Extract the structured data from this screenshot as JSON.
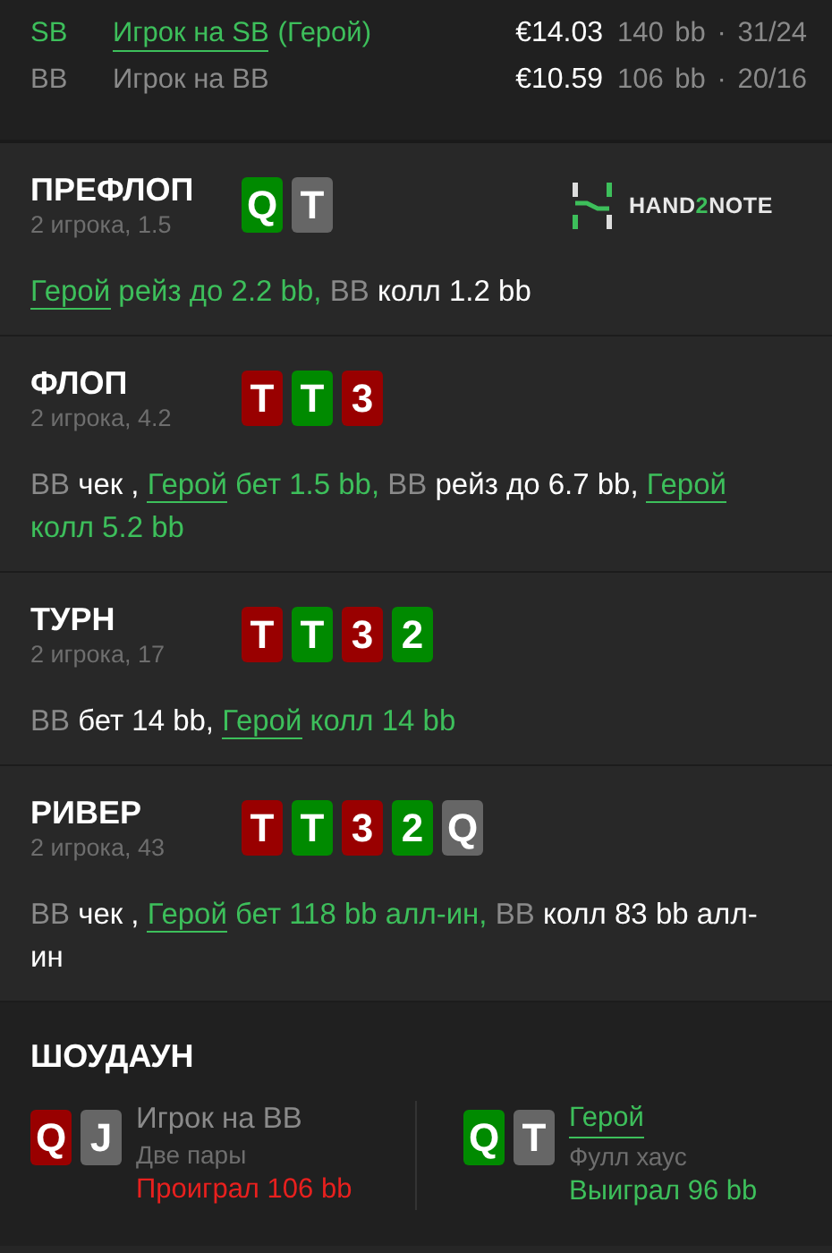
{
  "players": [
    {
      "position": "SB",
      "name": "Игрок на SB",
      "tag": "(Герой)",
      "hero": true,
      "stack": "€14.03",
      "stats": "140 bb · 31/24"
    },
    {
      "position": "BB",
      "name": "Игрок на BB",
      "hero": false,
      "stack": "€10.59",
      "stats": "106 bb · 20/16"
    }
  ],
  "streets": [
    {
      "title": "ПРЕФЛОП",
      "subtitle": "2 игрока, 1.5",
      "cards": [
        {
          "rank": "Q",
          "color": "#008a00"
        },
        {
          "rank": "T",
          "color": "#666666"
        }
      ],
      "logo": {
        "prefix": "HAND",
        "accent": "2",
        "suffix": "NOTE"
      },
      "actions": [
        {
          "actor": "Герой",
          "text": "рейз до 2.2 bb,",
          "hero": true
        },
        {
          "actor": "BB",
          "text": "колл 1.2 bb",
          "hero": false
        }
      ]
    },
    {
      "title": "ФЛОП",
      "subtitle": "2 игрока, 4.2",
      "cards": [
        {
          "rank": "T",
          "color": "#990000"
        },
        {
          "rank": "T",
          "color": "#008a00"
        },
        {
          "rank": "3",
          "color": "#990000"
        }
      ],
      "actions": [
        {
          "actor": "BB",
          "text": "чек ,",
          "hero": false
        },
        {
          "actor": "Герой",
          "text": "бет 1.5 bb,",
          "hero": true
        },
        {
          "actor": "BB",
          "text": "рейз до 6.7 bb,",
          "hero": false
        },
        {
          "actor": "Герой",
          "text": "колл 5.2 bb",
          "hero": true
        }
      ]
    },
    {
      "title": "ТУРН",
      "subtitle": "2 игрока, 17",
      "cards": [
        {
          "rank": "T",
          "color": "#990000"
        },
        {
          "rank": "T",
          "color": "#008a00"
        },
        {
          "rank": "3",
          "color": "#990000"
        },
        {
          "rank": "2",
          "color": "#008a00"
        }
      ],
      "actions": [
        {
          "actor": "BB",
          "text": "бет 14 bb,",
          "hero": false
        },
        {
          "actor": "Герой",
          "text": "колл 14 bb",
          "hero": true
        }
      ]
    },
    {
      "title": "РИВЕР",
      "subtitle": "2 игрока, 43",
      "cards": [
        {
          "rank": "T",
          "color": "#990000"
        },
        {
          "rank": "T",
          "color": "#008a00"
        },
        {
          "rank": "3",
          "color": "#990000"
        },
        {
          "rank": "2",
          "color": "#008a00"
        },
        {
          "rank": "Q",
          "color": "#666666"
        }
      ],
      "actions": [
        {
          "actor": "BB",
          "text": "чек ,",
          "hero": false
        },
        {
          "actor": "Герой",
          "text": "бет 118 bb алл-ин,",
          "hero": true
        },
        {
          "actor": "BB",
          "text": "колл 83 bb алл-ин",
          "hero": false
        }
      ]
    }
  ],
  "showdown": {
    "title": "ШОУДАУН",
    "players": [
      {
        "cards": [
          {
            "rank": "Q",
            "color": "#990000"
          },
          {
            "rank": "J",
            "color": "#666666"
          }
        ],
        "name": "Игрок на BB",
        "hero": false,
        "hand": "Две пары",
        "result": "Проиграл 106 bb",
        "won": false
      },
      {
        "cards": [
          {
            "rank": "Q",
            "color": "#008a00"
          },
          {
            "rank": "T",
            "color": "#666666"
          }
        ],
        "name": "Герой",
        "hero": true,
        "hand": "Фулл хаус",
        "result": "Выиграл 96 bb",
        "won": true
      }
    ]
  }
}
